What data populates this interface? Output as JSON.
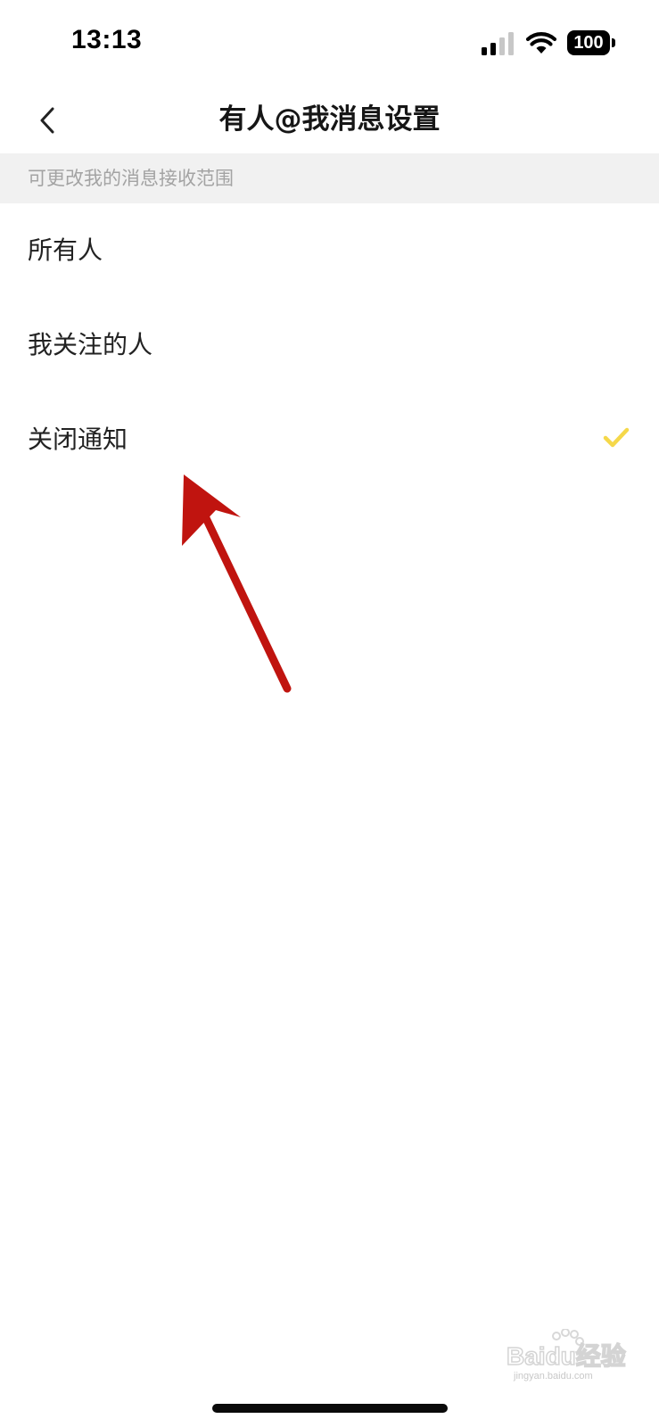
{
  "status_bar": {
    "time": "13:13",
    "battery_level": "100"
  },
  "nav": {
    "title": "有人@我消息设置"
  },
  "section": {
    "header": "可更改我的消息接收范围"
  },
  "options": [
    {
      "label": "所有人",
      "selected": false
    },
    {
      "label": "我关注的人",
      "selected": false
    },
    {
      "label": "关闭通知",
      "selected": true
    }
  ],
  "colors": {
    "check": "#f5d84a",
    "arrow": "#c0140f",
    "section_bg": "#f1f1f1"
  },
  "watermark": {
    "brand": "Baidu经验",
    "url": "jingyan.baidu.com"
  }
}
